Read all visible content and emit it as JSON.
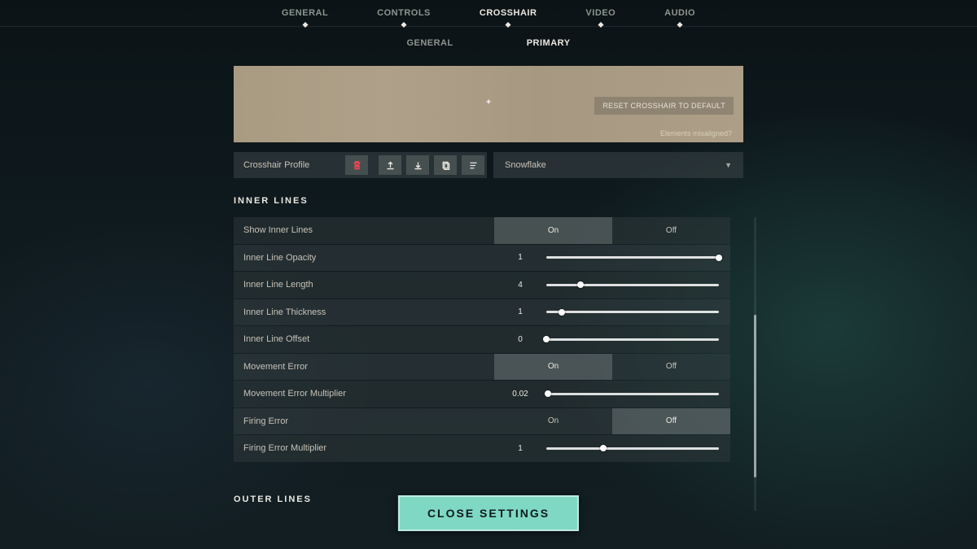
{
  "top_nav": {
    "items": [
      "GENERAL",
      "CONTROLS",
      "CROSSHAIR",
      "VIDEO",
      "AUDIO"
    ],
    "active_index": 2
  },
  "sub_nav": {
    "items": [
      "GENERAL",
      "PRIMARY"
    ],
    "active_index": 1
  },
  "preview": {
    "reset_label": "RESET CROSSHAIR TO DEFAULT",
    "misaligned_hint": "Elements misaligned?"
  },
  "profile_bar": {
    "label": "Crosshair Profile",
    "selected": "Snowflake"
  },
  "sections": {
    "inner_lines_title": "INNER  LINES",
    "outer_lines_title": "OUTER  LINES"
  },
  "toggles": {
    "on": "On",
    "off": "Off"
  },
  "inner_lines": [
    {
      "type": "toggle",
      "label": "Show Inner Lines",
      "value": "On"
    },
    {
      "type": "slider",
      "label": "Inner Line Opacity",
      "value": "1",
      "pct": 100
    },
    {
      "type": "slider",
      "label": "Inner Line Length",
      "value": "4",
      "pct": 20
    },
    {
      "type": "slider",
      "label": "Inner Line Thickness",
      "value": "1",
      "pct": 9
    },
    {
      "type": "slider",
      "label": "Inner Line Offset",
      "value": "0",
      "pct": 0
    },
    {
      "type": "toggle",
      "label": "Movement Error",
      "value": "On"
    },
    {
      "type": "slider",
      "label": "Movement Error Multiplier",
      "value": "0.02",
      "pct": 1
    },
    {
      "type": "toggle",
      "label": "Firing Error",
      "value": "Off"
    },
    {
      "type": "slider",
      "label": "Firing Error Multiplier",
      "value": "1",
      "pct": 33
    }
  ],
  "close_label": "CLOSE SETTINGS"
}
